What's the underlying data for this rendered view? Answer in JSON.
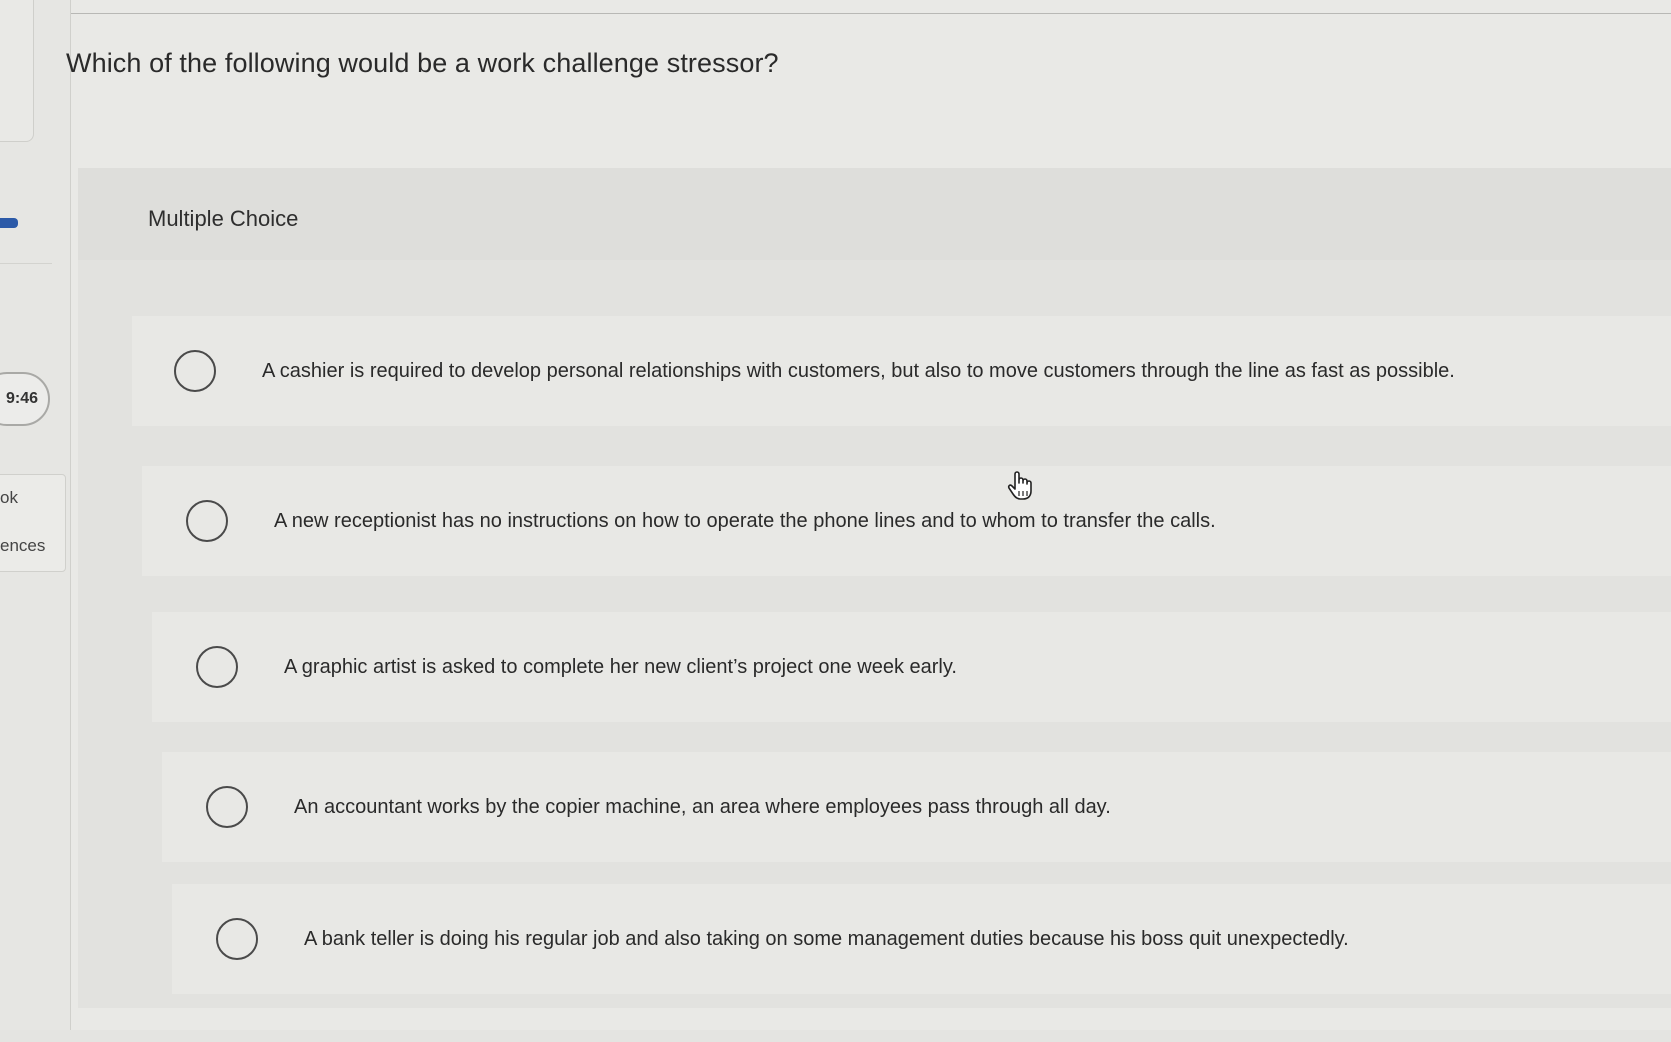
{
  "sidebar": {
    "timer": "9:46",
    "link_1": "ok",
    "link_2": "ences"
  },
  "question": {
    "text": "Which of the following would be a work challenge stressor?"
  },
  "answer": {
    "type_label": "Multiple Choice",
    "options": [
      {
        "label": "A cashier is required to develop personal relationships with customers, but also to move customers through the line as fast as possible.",
        "selected": false
      },
      {
        "label": "A new receptionist has no instructions on how to operate the phone lines and to whom to transfer the calls.",
        "selected": false
      },
      {
        "label": "A graphic artist is asked to complete her new client’s project one week early.",
        "selected": false
      },
      {
        "label": "An accountant works by the copier machine, an area where employees pass through all day.",
        "selected": false
      },
      {
        "label": "A bank teller is doing his regular job and also taking on some management duties because his boss quit unexpectedly.",
        "selected": false
      }
    ]
  },
  "colors": {
    "accent": "#2c5aa8",
    "background": "#e9e9e6",
    "panel": "#e2e2df"
  },
  "icons": {
    "cursor": "hand-pointer-icon"
  }
}
